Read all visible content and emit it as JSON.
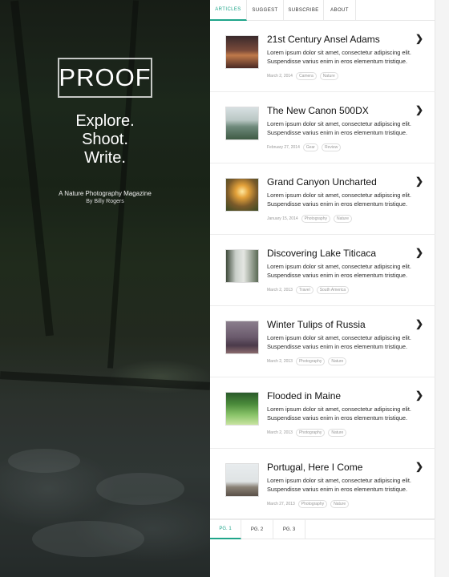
{
  "hero": {
    "logo": "PROOF",
    "tagline": [
      "Explore.",
      "Shoot.",
      "Write."
    ],
    "subtitle": "A Nature Photography Magazine",
    "author": "By Billy Rogers"
  },
  "tabs": [
    {
      "label": "ARTICLES",
      "active": true
    },
    {
      "label": "SUGGEST",
      "active": false
    },
    {
      "label": "SUBSCRIBE",
      "active": false
    },
    {
      "label": "ABOUT",
      "active": false
    }
  ],
  "body_text": "Lorem ipsum dolor sit amet, consectetur adipiscing elit. Suspendisse varius enim in eros elementum tristique.",
  "articles": [
    {
      "title": "21st Century Ansel Adams",
      "body": "Lorem ipsum dolor sit amet, consectetur adipiscing elit. Suspendisse varius enim in eros elementum tristique.",
      "date": "March 2, 2014",
      "tags": [
        "Camera",
        "Nature"
      ]
    },
    {
      "title": "The New Canon 500DX",
      "body": "Lorem ipsum dolor sit amet, consectetur adipiscing elit. Suspendisse varius enim in eros elementum tristique.",
      "date": "February 27, 2014",
      "tags": [
        "Gear",
        "Review"
      ]
    },
    {
      "title": "Grand Canyon Uncharted",
      "body": "Lorem ipsum dolor sit amet, consectetur adipiscing elit. Suspendisse varius enim in eros elementum tristique.",
      "date": "January 15, 2014",
      "tags": [
        "Photography",
        "Nature"
      ]
    },
    {
      "title": "Discovering Lake Titicaca",
      "body": "Lorem ipsum dolor sit amet, consectetur adipiscing elit. Suspendisse varius enim in eros elementum tristique.",
      "date": "March 2, 2013",
      "tags": [
        "Travel",
        "South America"
      ]
    },
    {
      "title": "Winter Tulips of Russia",
      "body": "Lorem ipsum dolor sit amet, consectetur adipiscing elit. Suspendisse varius enim in eros elementum tristique.",
      "date": "March 2, 2013",
      "tags": [
        "Photography",
        "Nature"
      ]
    },
    {
      "title": "Flooded in Maine",
      "body": "Lorem ipsum dolor sit amet, consectetur adipiscing elit. Suspendisse varius enim in eros elementum tristique.",
      "date": "March 2, 2013",
      "tags": [
        "Photography",
        "Nature"
      ]
    },
    {
      "title": "Portugal, Here I Come",
      "body": "Lorem ipsum dolor sit amet, consectetur adipiscing elit. Suspendisse varius enim in eros elementum tristique.",
      "date": "March 27, 2013",
      "tags": [
        "Photography",
        "Nature"
      ]
    }
  ],
  "pager": [
    {
      "label": "PG. 1",
      "active": true
    },
    {
      "label": "PG. 2",
      "active": false
    },
    {
      "label": "PG. 3",
      "active": false
    }
  ],
  "colors": {
    "accent": "#1fa58a"
  },
  "icons": {
    "article_arrow": "chevron-right-icon"
  }
}
